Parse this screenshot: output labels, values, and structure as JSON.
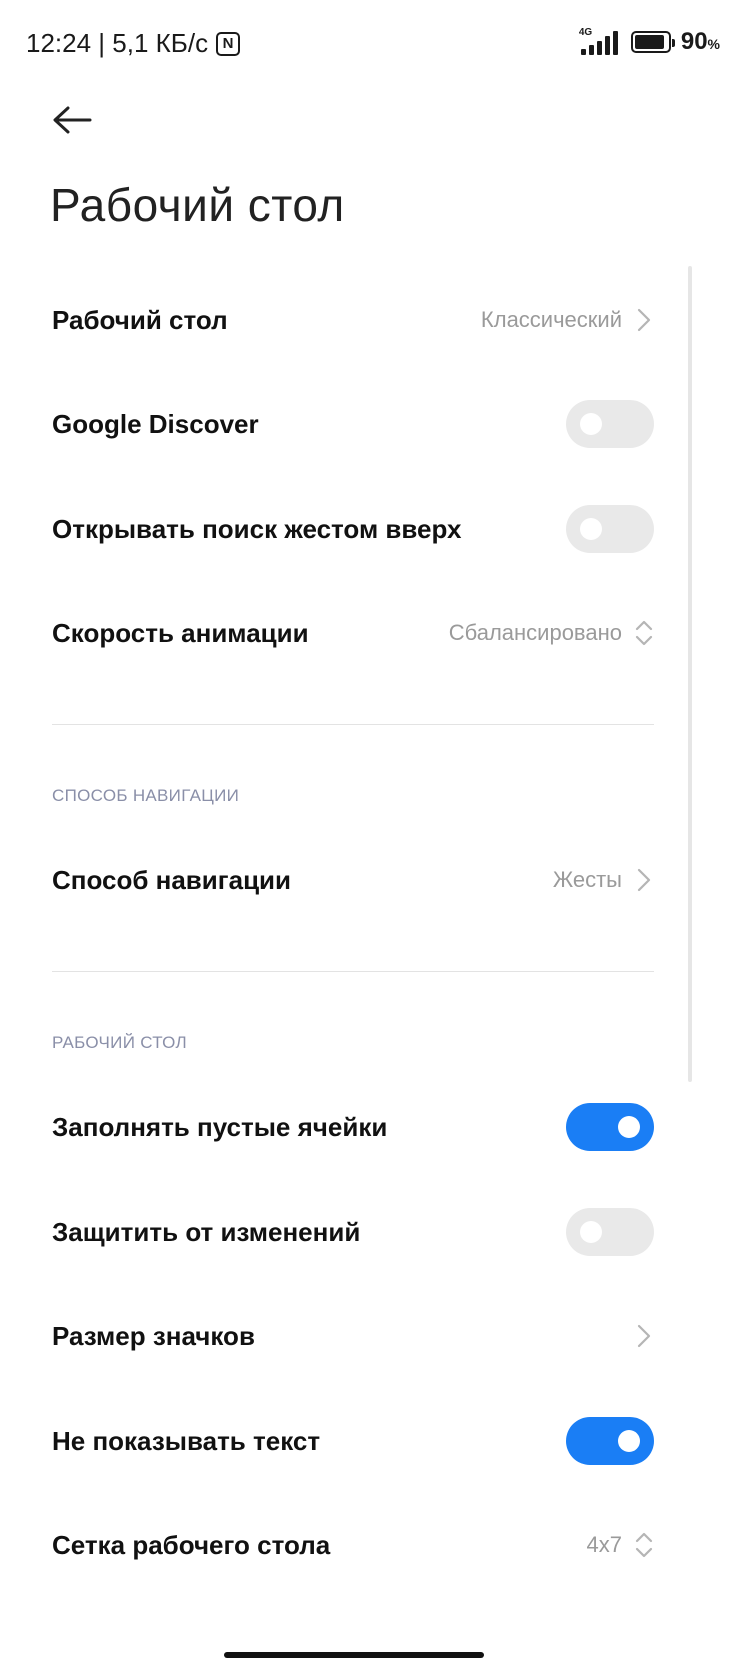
{
  "status_bar": {
    "time_speed": "12:24 | 5,1 КБ/с",
    "nfc_icon_label": "N",
    "network_type": "4G",
    "battery_percent": "90",
    "battery_percent_sign": "%",
    "battery_level": 0.9
  },
  "header": {
    "title": "Рабочий стол"
  },
  "settings": {
    "desktop_mode": {
      "label": "Рабочий стол",
      "value": "Классический"
    },
    "google_discover": {
      "label": "Google Discover",
      "enabled": false
    },
    "swipe_up_search": {
      "label": "Открывать поиск жестом вверх",
      "enabled": false
    },
    "animation_speed": {
      "label": "Скорость анимации",
      "value": "Сбалансировано"
    }
  },
  "navigation_section": {
    "header": "СПОСОБ НАВИГАЦИИ",
    "navigation_method": {
      "label": "Способ навигации",
      "value": "Жесты"
    }
  },
  "desktop_section": {
    "header": "РАБОЧИЙ СТОЛ",
    "fill_empty_cells": {
      "label": "Заполнять пустые ячейки",
      "enabled": true
    },
    "lock_layout": {
      "label": "Защитить от изменений",
      "enabled": false
    },
    "icon_size": {
      "label": "Размер значков"
    },
    "hide_text": {
      "label": "Не показывать текст",
      "enabled": true
    },
    "grid": {
      "label": "Сетка рабочего стола",
      "value": "4x7"
    }
  },
  "colors": {
    "accent": "#1a7ef5",
    "toggle_off": "#e9e9e9",
    "secondary_text": "#9a9a9a",
    "section_header": "#8a8fa8"
  }
}
